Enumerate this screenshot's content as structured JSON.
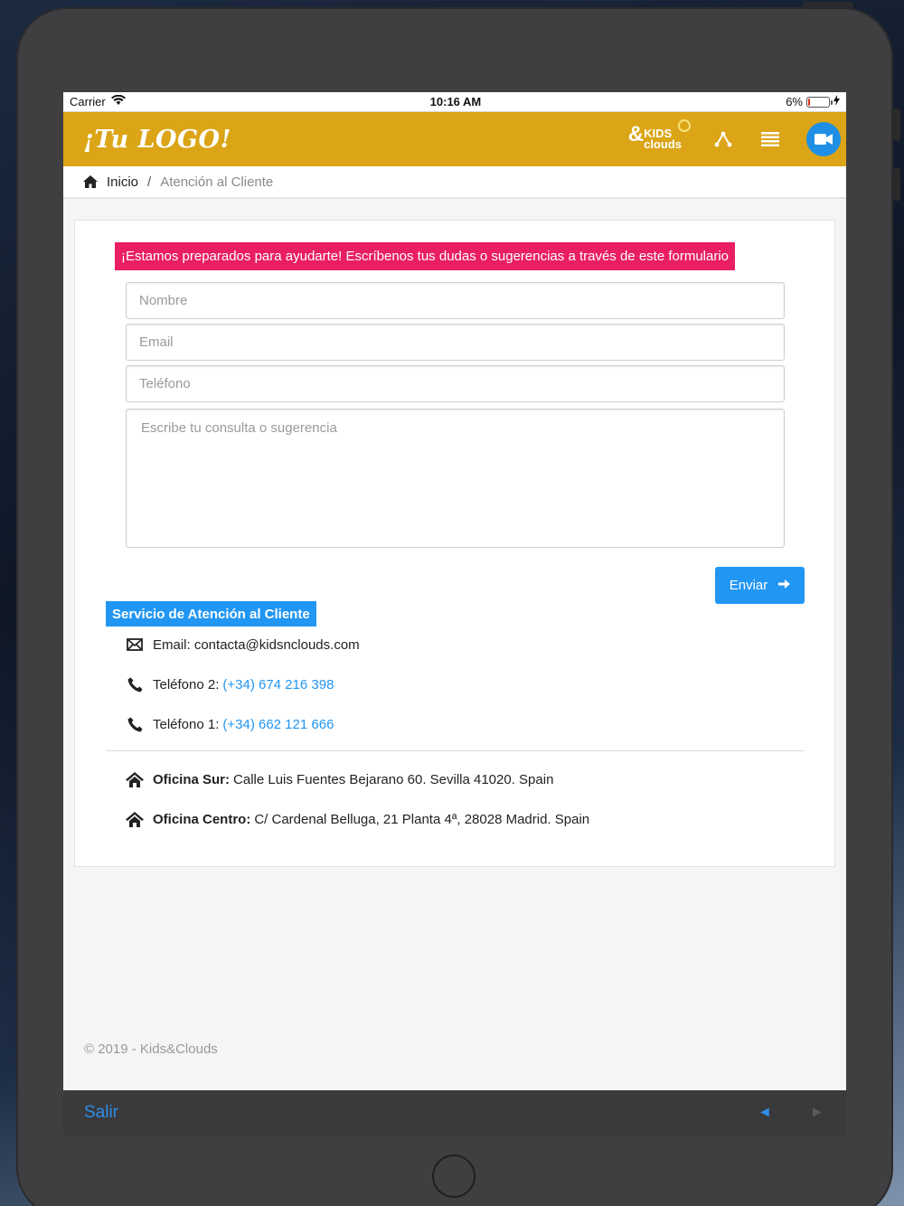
{
  "status_bar": {
    "carrier": "Carrier",
    "time": "10:16 AM",
    "battery": "6%",
    "icons": [
      "wifi-icon",
      "battery-icon",
      "charging-bolt-icon"
    ]
  },
  "app_bar": {
    "logo": "¡Tu LOGO!",
    "brand": {
      "amp": "&",
      "top": "KIDS",
      "bottom": "clouds"
    },
    "icons": [
      "share-icon",
      "menu-icon",
      "video-camera-icon"
    ],
    "color": "#dba517"
  },
  "breadcrumb": {
    "home": "Inicio",
    "separator": "/",
    "current": "Atención al Cliente"
  },
  "form": {
    "intro": "¡Estamos preparados para ayudarte! Escríbenos tus dudas o sugerencias a través de este formulario",
    "name_placeholder": "Nombre",
    "email_placeholder": "Email",
    "phone_placeholder": "Teléfono",
    "message_placeholder": "Escribe tu consulta o sugerencia",
    "submit_label": "Enviar",
    "intro_color": "#e91e63",
    "accent_color": "#2196f3"
  },
  "contact": {
    "title": "Servicio de Atención al Cliente",
    "email": "Email: contacta@kidsnclouds.com",
    "phone2_label": "Teléfono 2:",
    "phone2_value": "(+34) 674 216 398",
    "phone1_label": "Teléfono 1:",
    "phone1_value": "(+34) 662 121 666",
    "office_south_label": "Oficina Sur:",
    "office_south_address": "Calle Luis Fuentes Bejarano 60. Sevilla 41020. Spain",
    "office_center_label": "Oficina Centro:",
    "office_center_address": "C/ Cardenal Belluga, 21 Planta 4ª, 28028 Madrid. Spain"
  },
  "footer": {
    "copyright": "© 2019 - Kids&Clouds"
  },
  "toolbar": {
    "exit_label": "Salir",
    "back_icon": "◄",
    "forward_icon": "►"
  }
}
